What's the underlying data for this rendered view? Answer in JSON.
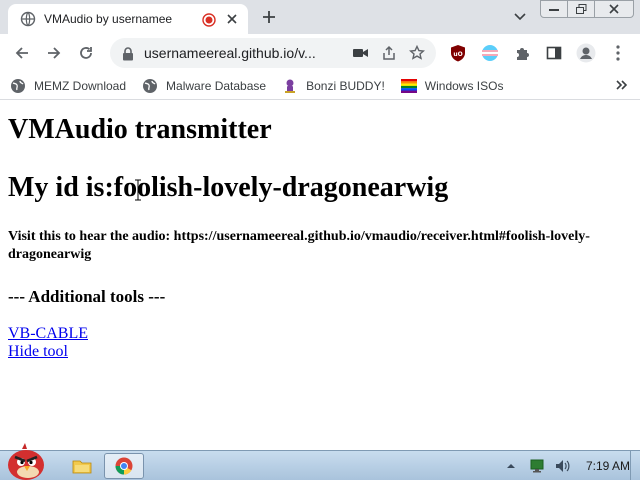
{
  "browser": {
    "tab": {
      "title": "VMAudio by usernamee"
    },
    "address": {
      "url": "usernameereal.github.io/v..."
    },
    "bookmarks": [
      {
        "label": "MEMZ Download",
        "icon": "globe-icon"
      },
      {
        "label": "Malware Database",
        "icon": "globe-icon"
      },
      {
        "label": "Bonzi BUDDY!",
        "icon": "bonzi-icon"
      },
      {
        "label": "Windows ISOs",
        "icon": "windows-flag-icon"
      }
    ]
  },
  "page": {
    "title": "VMAudio transmitter",
    "id_line": "My id is:foolish-lovely-dragonearwig",
    "visit_text": "Visit this to hear the audio: https://usernameereal.github.io/vmaudio/receiver.html#foolish-lovely-dragonearwig",
    "tools_heading": "--- Additional tools ---",
    "links": {
      "vb_cable": "VB-CABLE",
      "hide_tool": "Hide tool"
    }
  },
  "taskbar": {
    "clock": "7:19 AM"
  },
  "colors": {
    "link": "#0000ee",
    "tab_strip": "#dee1e6",
    "omnibox": "#f1f3f4",
    "recording_red": "#d93025",
    "taskbar": "#b7cfe6"
  }
}
